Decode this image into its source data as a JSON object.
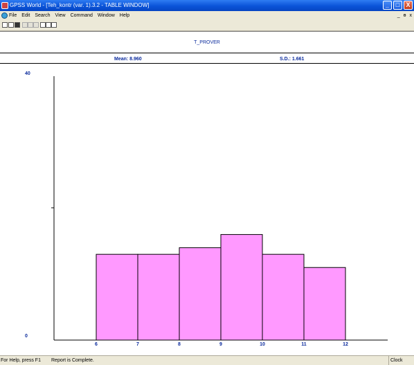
{
  "window": {
    "title": "GPSS World - [Teh_kontr (var. 1).3.2  - TABLE WINDOW]",
    "minimize": "_",
    "maximize": "□",
    "close": "X"
  },
  "menu": {
    "items": [
      "File",
      "Edit",
      "Search",
      "View",
      "Command",
      "Window",
      "Help"
    ],
    "mdi_minimize": "_",
    "mdi_restore": "ɵ",
    "mdi_close": "x"
  },
  "table": {
    "name": "T_PROVER",
    "mean_text": "Mean: 8.960",
    "sd_text": "S.D.: 1.661"
  },
  "chart_data": {
    "type": "bar",
    "x_edges": [
      6,
      7,
      8,
      9,
      10,
      11,
      12
    ],
    "values": [
      13,
      13,
      14,
      16,
      13,
      11
    ],
    "ylim": [
      0,
      40
    ],
    "y_tick_labels": [
      "40",
      "0"
    ],
    "bar_color": "#ff99ff"
  },
  "status": {
    "help": "For Help, press F1",
    "report": "Report is Complete.",
    "clock": "Clock"
  }
}
